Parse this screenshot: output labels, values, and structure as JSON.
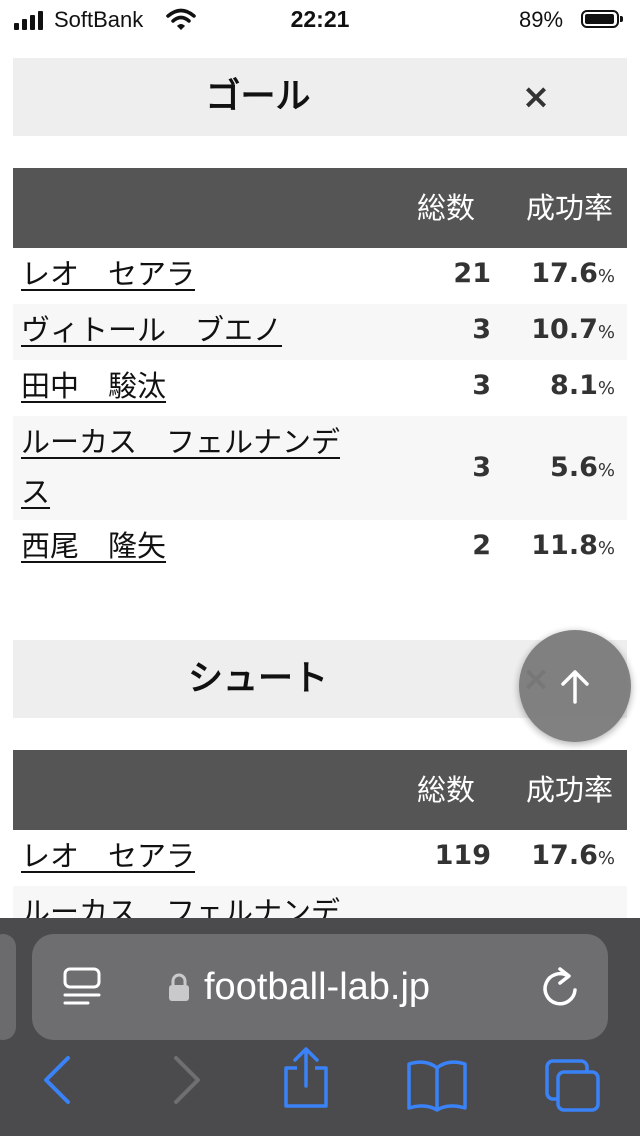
{
  "status_bar": {
    "carrier": "SoftBank",
    "time": "22:21",
    "battery": "89%"
  },
  "sections": [
    {
      "title": "ゴール",
      "close": "×",
      "headers": {
        "count": "総数",
        "rate": "成功率"
      },
      "rows": [
        {
          "name": "レオ　セアラ",
          "count": "21",
          "rate": "17.6",
          "unit": "%"
        },
        {
          "name": "ヴィトール　ブエノ",
          "count": "3",
          "rate": "10.7",
          "unit": "%"
        },
        {
          "name": "田中　駿汰",
          "count": "3",
          "rate": "8.1",
          "unit": "%"
        },
        {
          "name_line1": "ルーカス　フェルナンデ",
          "name_line2": "ス",
          "count": "3",
          "rate": "5.6",
          "unit": "%"
        },
        {
          "name": "西尾　隆矢",
          "count": "2",
          "rate": "11.8",
          "unit": "%"
        }
      ]
    },
    {
      "title": "シュート",
      "close": "×",
      "headers": {
        "count": "総数",
        "rate": "成功率"
      },
      "rows": [
        {
          "name": "レオ　セアラ",
          "count": "119",
          "rate": "17.6",
          "unit": "%"
        },
        {
          "name": "ルーカス　フェルナンデ"
        }
      ]
    }
  ],
  "browser": {
    "url": "football-lab.jp"
  },
  "colors": {
    "table_header_bg": "#555555",
    "section_header_bg": "#eeeeee",
    "toolbar_bg": "#4b4b4d",
    "accent_blue": "#3a82f7"
  }
}
